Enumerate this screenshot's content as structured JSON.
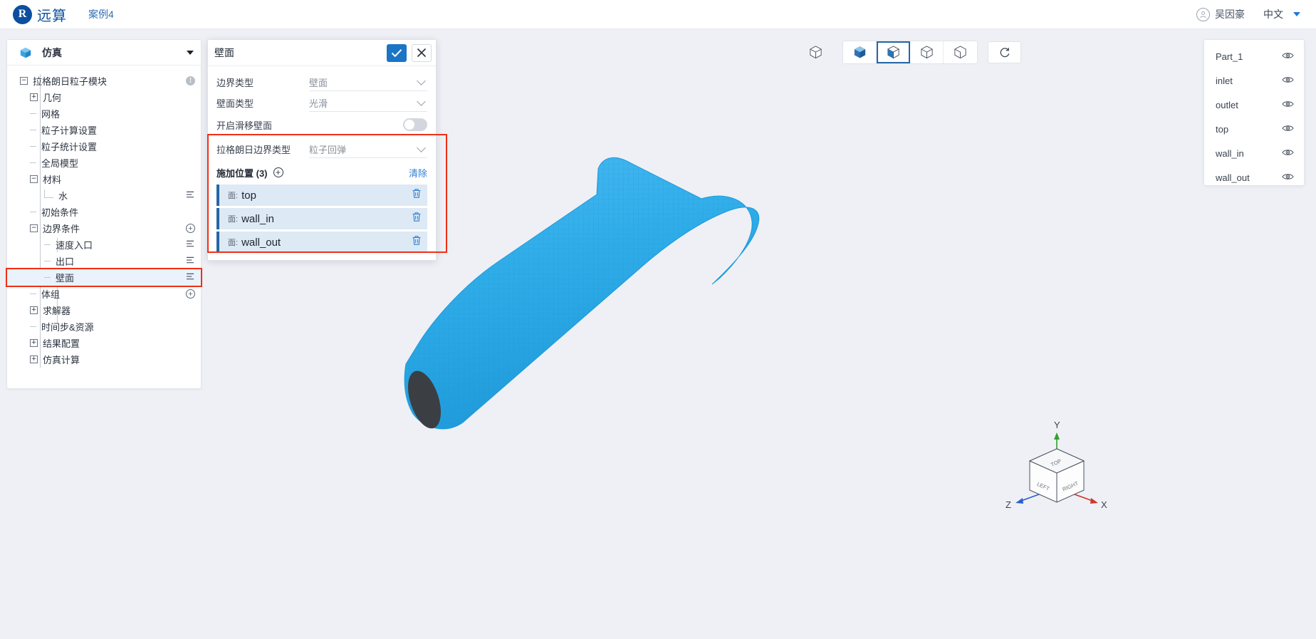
{
  "app": {
    "brand": "远算",
    "logo_letter": "R",
    "case_name": "案例4",
    "user_name": "吴因豪",
    "language": "中文",
    "brand_color": "#0b4f9e",
    "accent_color": "#1b74c4",
    "highlight_color": "#f03018"
  },
  "tree": {
    "header_label": "仿真",
    "header_icon": "cube-icon",
    "nodes": [
      {
        "label": "拉格朗日粒子模块",
        "depth": 0,
        "toggle": "minus",
        "right_icon": "info-icon"
      },
      {
        "label": "几何",
        "depth": 1,
        "toggle": "plus",
        "right_icon": ""
      },
      {
        "label": "网格",
        "depth": 1,
        "toggle": "leaf",
        "right_icon": ""
      },
      {
        "label": "粒子计算设置",
        "depth": 1,
        "toggle": "leaf",
        "right_icon": ""
      },
      {
        "label": "粒子统计设置",
        "depth": 1,
        "toggle": "leaf",
        "right_icon": ""
      },
      {
        "label": "全局模型",
        "depth": 1,
        "toggle": "leaf",
        "right_icon": ""
      },
      {
        "label": "材料",
        "depth": 1,
        "toggle": "minus",
        "right_icon": ""
      },
      {
        "label": "水",
        "depth": 2,
        "toggle": "elbow",
        "right_icon": "list-icon"
      },
      {
        "label": "初始条件",
        "depth": 1,
        "toggle": "leaf",
        "right_icon": ""
      },
      {
        "label": "边界条件",
        "depth": 1,
        "toggle": "minus",
        "right_icon": "plus-circle-icon"
      },
      {
        "label": "速度入口",
        "depth": 2,
        "toggle": "leaf2",
        "right_icon": "list-icon"
      },
      {
        "label": "出口",
        "depth": 2,
        "toggle": "leaf2",
        "right_icon": "list-icon"
      },
      {
        "label": "壁面",
        "depth": 2,
        "toggle": "leaf2",
        "right_icon": "list-icon",
        "selected": true,
        "highlighted": true
      },
      {
        "label": "体组",
        "depth": 1,
        "toggle": "leaf",
        "right_icon": "plus-circle-icon"
      },
      {
        "label": "求解器",
        "depth": 1,
        "toggle": "plus",
        "right_icon": ""
      },
      {
        "label": "时间步&资源",
        "depth": 1,
        "toggle": "leaf",
        "right_icon": ""
      },
      {
        "label": "结果配置",
        "depth": 1,
        "toggle": "plus",
        "right_icon": ""
      },
      {
        "label": "仿真计算",
        "depth": 1,
        "toggle": "plus",
        "right_icon": ""
      }
    ]
  },
  "dialog": {
    "title": "壁面",
    "confirm_icon": "check-icon",
    "cancel_icon": "close-icon",
    "fields": [
      {
        "label": "边界类型",
        "value": "壁面",
        "control": "select"
      },
      {
        "label": "壁面类型",
        "value": "光滑",
        "control": "select"
      },
      {
        "label": "开启滑移壁面",
        "value": "",
        "control": "toggle",
        "toggle_on": false
      },
      {
        "label": "拉格朗日边界类型",
        "value": "粒子回弹",
        "control": "select"
      }
    ],
    "locations_section": {
      "title": "施加位置 (3)",
      "add_icon": "plus-circle-icon",
      "clear_label": "清除",
      "items": [
        {
          "prefix": "面:",
          "name": "top",
          "delete_icon": "trash-icon"
        },
        {
          "prefix": "面:",
          "name": "wall_in",
          "delete_icon": "trash-icon"
        },
        {
          "prefix": "面:",
          "name": "wall_out",
          "delete_icon": "trash-icon"
        }
      ]
    }
  },
  "view_toolbar": {
    "standalone_icon": "cube-wireframe-icon",
    "buttons": [
      {
        "icon": "cube-solid-icon",
        "active": false
      },
      {
        "icon": "cube-solid-edges-icon",
        "active": true
      },
      {
        "icon": "cube-wireframe-icon",
        "active": false
      },
      {
        "icon": "cube-outline-icon",
        "active": false
      }
    ],
    "reset_icon": "refresh-icon"
  },
  "parts_panel": {
    "rows": [
      {
        "label": "Part_1",
        "visibility_icon": "eye-icon"
      },
      {
        "label": "inlet",
        "visibility_icon": "eye-icon"
      },
      {
        "label": "outlet",
        "visibility_icon": "eye-icon"
      },
      {
        "label": "top",
        "visibility_icon": "eye-icon"
      },
      {
        "label": "wall_in",
        "visibility_icon": "eye-icon"
      },
      {
        "label": "wall_out",
        "visibility_icon": "eye-icon"
      }
    ]
  },
  "axis_widget": {
    "axis_y": "Y",
    "axis_x": "X",
    "axis_z": "Z",
    "face_top": "TOP",
    "face_left": "LEFT",
    "face_right": "RIGHT"
  }
}
